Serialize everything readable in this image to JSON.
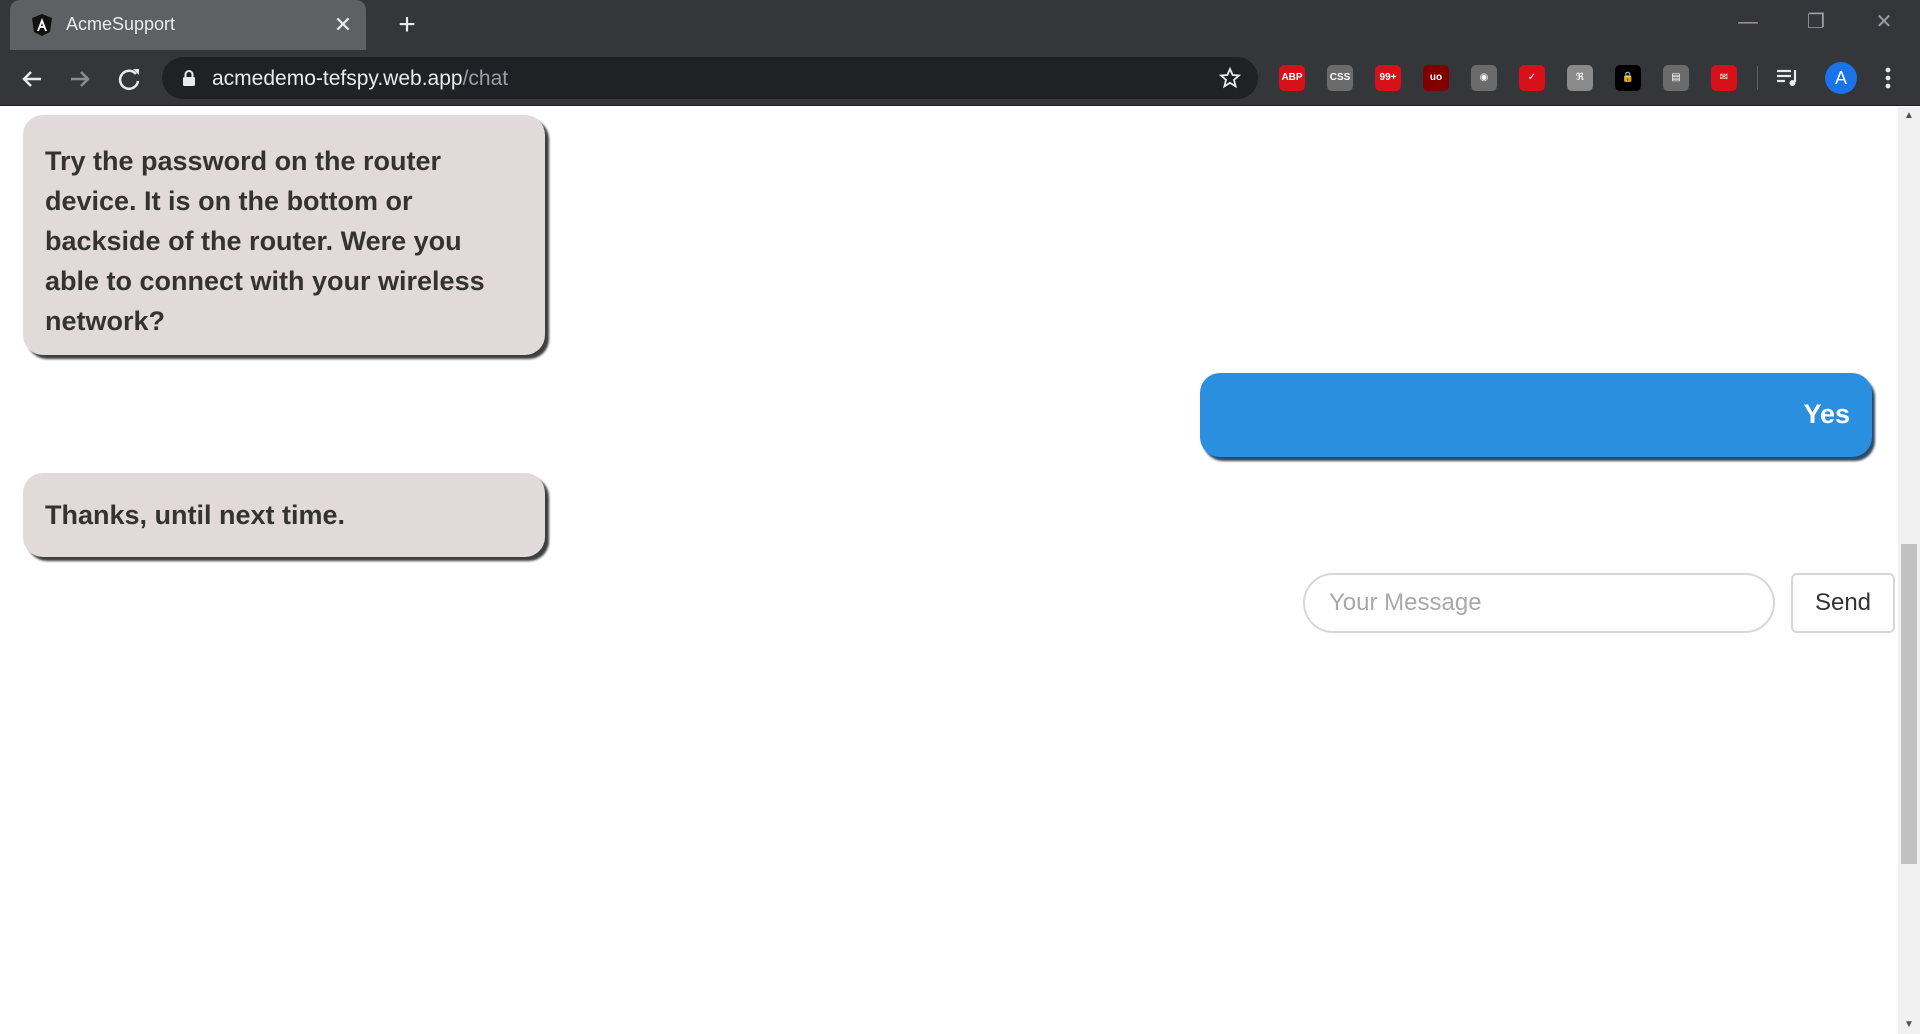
{
  "browser": {
    "tab": {
      "title": "AcmeSupport",
      "close_glyph": "✕"
    },
    "new_tab_glyph": "+",
    "window_controls": {
      "minimize": "—",
      "restore": "❐",
      "close": "✕"
    },
    "url": {
      "domain": "acmedemo-tefspy.web.app",
      "path": "/chat"
    },
    "extensions": [
      {
        "name": "adblock-plus-icon",
        "label": "ABP",
        "color": "#d9101a"
      },
      {
        "name": "css-viewer-icon",
        "label": "CSS",
        "color": "#6b6b6b"
      },
      {
        "name": "notification-icon",
        "label": "99+",
        "color": "#d9101a"
      },
      {
        "name": "ublock-icon",
        "label": "uo",
        "color": "#800000"
      },
      {
        "name": "camera-icon",
        "label": "◉",
        "color": "#6b6b6b"
      },
      {
        "name": "checker-icon",
        "label": "✓",
        "color": "#d9101a"
      },
      {
        "name": "puzzle-icon",
        "label": "ℜ",
        "color": "#8a8a8a"
      },
      {
        "name": "lock-extension-icon",
        "label": "🔒",
        "color": "#000000"
      },
      {
        "name": "printer-icon",
        "label": "▤",
        "color": "#6b6b6b"
      },
      {
        "name": "mail-icon",
        "label": "✉",
        "color": "#d9101a"
      }
    ],
    "avatar_letter": "A"
  },
  "chat": {
    "messages": [
      {
        "from": "bot",
        "text": "Try the password on the router device. It is on the bottom or backside of the router. Were you able to connect with your wireless network?"
      },
      {
        "from": "user",
        "text": "Yes"
      },
      {
        "from": "bot",
        "text": "Thanks, until next time."
      }
    ],
    "input_placeholder": "Your Message",
    "send_label": "Send"
  },
  "colors": {
    "bot_bubble": "#e2d9da",
    "user_bubble": "#2b8fe0",
    "chrome_dark": "#35363a"
  }
}
